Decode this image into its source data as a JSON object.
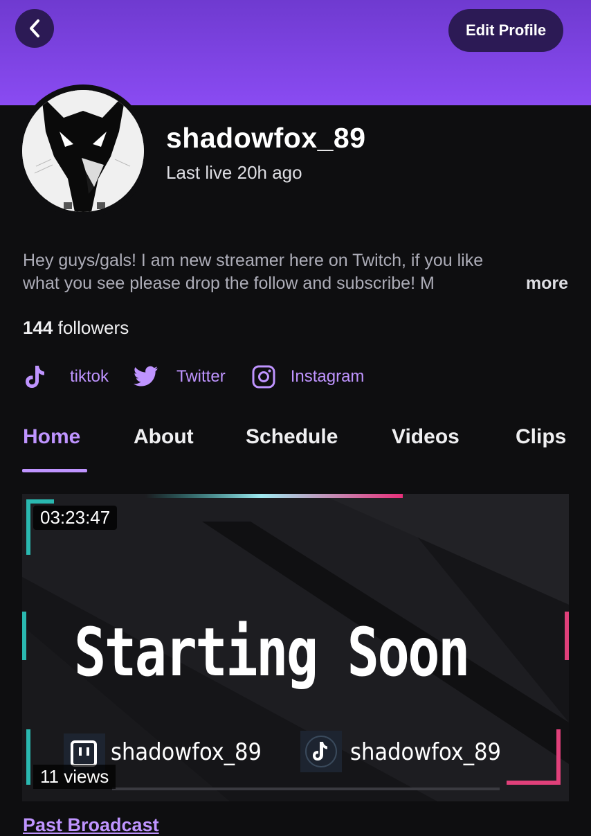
{
  "header": {
    "edit_profile_label": "Edit Profile"
  },
  "profile": {
    "username": "shadowfox_89",
    "last_live": "Last live 20h ago",
    "bio_line1": "Hey guys/gals! I am new streamer here on Twitch, if you like",
    "bio_line2": "what you see please drop the follow and subscribe! M",
    "bio_more": "more",
    "followers_count": "144",
    "followers_label": "followers"
  },
  "socials": [
    {
      "label": "tiktok",
      "icon": "tiktok-icon"
    },
    {
      "label": "Twitter",
      "icon": "twitter-icon"
    },
    {
      "label": "Instagram",
      "icon": "instagram-icon"
    }
  ],
  "tabs": [
    {
      "label": "Home",
      "active": true
    },
    {
      "label": "About",
      "active": false
    },
    {
      "label": "Schedule",
      "active": false
    },
    {
      "label": "Videos",
      "active": false
    },
    {
      "label": "Clips",
      "active": false
    }
  ],
  "video": {
    "duration": "03:23:47",
    "views": "11 views",
    "thumbnail_title": "Starting Soon",
    "thumbnail_twitch_handle": "shadowfox_89",
    "thumbnail_tiktok_handle": "shadowfox_89"
  },
  "section": {
    "title": "Past Broadcast"
  },
  "colors": {
    "banner": "#8a4bf2",
    "accent": "#bf94ff",
    "background": "#0e0e10",
    "button_bg": "#2c1a55"
  }
}
